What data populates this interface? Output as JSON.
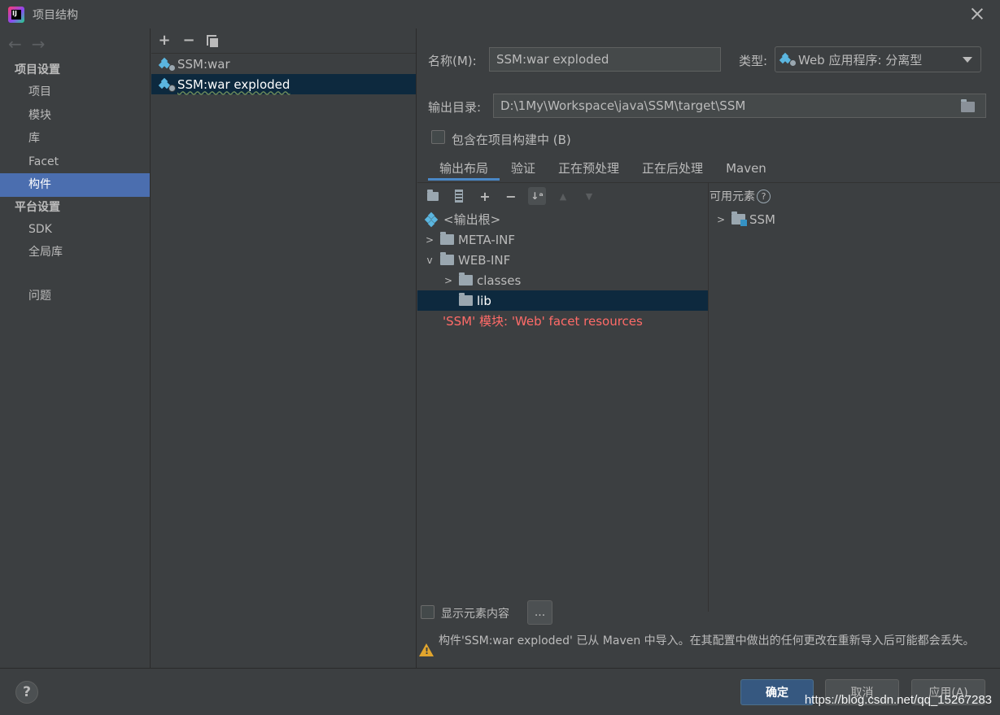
{
  "window": {
    "title": "项目结构"
  },
  "nav": {
    "group_project": "项目设置",
    "items_project": [
      "项目",
      "模块",
      "库",
      "Facet",
      "构件"
    ],
    "group_platform": "平台设置",
    "items_platform": [
      "SDK",
      "全局库"
    ],
    "problems": "问题",
    "selected": "构件"
  },
  "artifacts": {
    "toolbar": {
      "add": "+",
      "remove": "−"
    },
    "items": [
      "SSM:war",
      "SSM:war exploded"
    ],
    "selected": "SSM:war exploded"
  },
  "form": {
    "name_label": "名称(M):",
    "name_value": "SSM:war exploded",
    "type_label": "类型:",
    "type_value": "Web 应用程序: 分离型",
    "output_label": "输出目录:",
    "output_value": "D:\\1My\\Workspace\\java\\SSM\\target\\SSM",
    "include_build_label": "包含在项目构建中 (B)"
  },
  "tabs": [
    "输出布局",
    "验证",
    "正在预处理",
    "正在后处理",
    "Maven"
  ],
  "layout_tree": {
    "root": "<输出根>",
    "meta_inf": "META-INF",
    "web_inf": "WEB-INF",
    "classes": "classes",
    "lib": "lib",
    "facet_resources": "'SSM' 模块: 'Web' facet resources"
  },
  "available": {
    "title": "可用元素",
    "items": [
      "SSM"
    ]
  },
  "show_content": {
    "label": "显示元素内容",
    "button": "..."
  },
  "warning": "构件'SSM:war exploded' 已从 Maven 中导入。在其配置中做出的任何更改在重新导入后可能都会丢失。",
  "footer": {
    "help": "?",
    "ok": "确定",
    "cancel": "取消",
    "apply": "应用(A)",
    "watermark": "https://blog.csdn.net/qq_15267283"
  },
  "colors": {
    "selection": "#4b6eaf",
    "tree_selection": "#0d293e",
    "error_text": "#ff6b68",
    "warning": "#e2a52d"
  }
}
